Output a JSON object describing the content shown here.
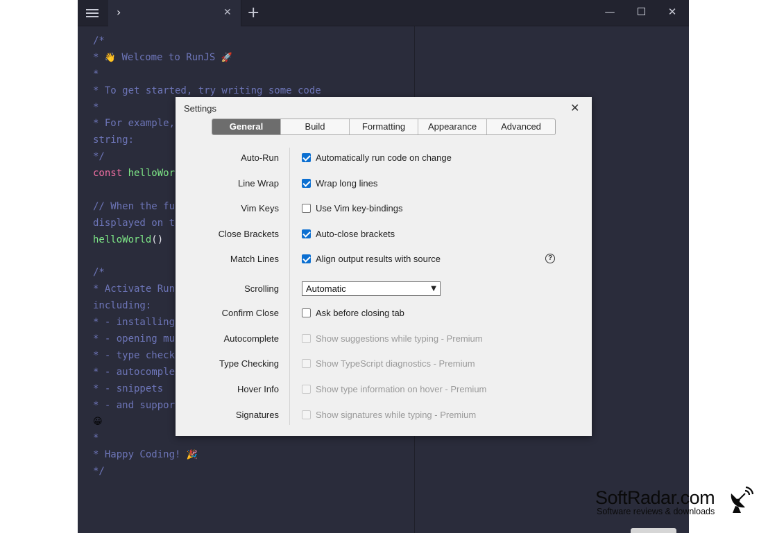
{
  "titlebar": {
    "tab_chevron": "›",
    "tab_close": "✕",
    "new_tab": "+",
    "minimize": "—",
    "close": "✕"
  },
  "code": [
    [
      {
        "t": "/*",
        "c": "c-comment"
      }
    ],
    [
      {
        "t": "* ",
        "c": "c-comment"
      },
      {
        "t": "👋",
        "c": "emoji"
      },
      {
        "t": " Welcome to RunJS ",
        "c": "c-comment"
      },
      {
        "t": "🚀",
        "c": "emoji"
      }
    ],
    [
      {
        "t": "*",
        "c": "c-comment"
      }
    ],
    [
      {
        "t": "* To get started, try writing some code",
        "c": "c-comment"
      }
    ],
    [
      {
        "t": "*",
        "c": "c-comment"
      }
    ],
    [
      {
        "t": "* For example,",
        "c": "c-comment"
      }
    ],
    [
      {
        "t": "string:",
        "c": "c-comment"
      }
    ],
    [
      {
        "t": "*/",
        "c": "c-comment"
      }
    ],
    [
      {
        "t": "const ",
        "c": "c-kw"
      },
      {
        "t": "helloWor",
        "c": "c-fn"
      }
    ],
    [
      {
        "t": "",
        "c": "c-comment"
      }
    ],
    [
      {
        "t": "// When the fu",
        "c": "c-comment"
      }
    ],
    [
      {
        "t": "displayed on t",
        "c": "c-comment"
      }
    ],
    [
      {
        "t": "helloWorld",
        "c": "c-fn"
      },
      {
        "t": "()",
        "c": "c-punc"
      }
    ],
    [
      {
        "t": "",
        "c": "c-comment"
      }
    ],
    [
      {
        "t": "/*",
        "c": "c-comment"
      }
    ],
    [
      {
        "t": "* Activate Run",
        "c": "c-comment"
      }
    ],
    [
      {
        "t": "including:",
        "c": "c-comment"
      }
    ],
    [
      {
        "t": "* - installing",
        "c": "c-comment"
      }
    ],
    [
      {
        "t": "* - opening mu",
        "c": "c-comment"
      }
    ],
    [
      {
        "t": "* - type check",
        "c": "c-comment"
      }
    ],
    [
      {
        "t": "* - autocomple",
        "c": "c-comment"
      }
    ],
    [
      {
        "t": "* - snippets",
        "c": "c-comment"
      }
    ],
    [
      {
        "t": "* - and suppor",
        "c": "c-comment"
      }
    ],
    [
      {
        "t": "😀",
        "c": "emoji"
      }
    ],
    [
      {
        "t": "*",
        "c": "c-comment"
      }
    ],
    [
      {
        "t": "* Happy Coding! ",
        "c": "c-comment"
      },
      {
        "t": "🎉",
        "c": "emoji"
      }
    ],
    [
      {
        "t": "*/",
        "c": "c-comment"
      }
    ]
  ],
  "settings": {
    "title": "Settings",
    "close": "✕",
    "tabs": [
      {
        "label": "General",
        "active": true
      },
      {
        "label": "Build",
        "active": false
      },
      {
        "label": "Formatting",
        "active": false
      },
      {
        "label": "Appearance",
        "active": false
      },
      {
        "label": "Advanced",
        "active": false
      }
    ],
    "rows": {
      "auto_run": {
        "label": "Auto-Run",
        "text": "Automatically run code on change",
        "checked": true
      },
      "line_wrap": {
        "label": "Line Wrap",
        "text": "Wrap long lines",
        "checked": true
      },
      "vim_keys": {
        "label": "Vim Keys",
        "text": "Use Vim key-bindings",
        "checked": false
      },
      "close_brackets": {
        "label": "Close Brackets",
        "text": "Auto-close brackets",
        "checked": true
      },
      "match_lines": {
        "label": "Match Lines",
        "text": "Align output results with source",
        "checked": true,
        "help": "?"
      },
      "scrolling": {
        "label": "Scrolling",
        "value": "Automatic"
      },
      "confirm_close": {
        "label": "Confirm Close",
        "text": "Ask before closing tab",
        "checked": false
      },
      "autocomplete": {
        "label": "Autocomplete",
        "text": "Show suggestions while typing - Premium",
        "checked": false,
        "disabled": true
      },
      "type_checking": {
        "label": "Type Checking",
        "text": "Show TypeScript diagnostics - Premium",
        "checked": false,
        "disabled": true
      },
      "hover_info": {
        "label": "Hover Info",
        "text": "Show type information on hover - Premium",
        "checked": false,
        "disabled": true
      },
      "signatures": {
        "label": "Signatures",
        "text": "Show signatures while typing - Premium",
        "checked": false,
        "disabled": true
      }
    }
  },
  "watermark": {
    "title": "SoftRadar.com",
    "subtitle": "Software reviews & downloads"
  },
  "colors": {
    "editor_bg": "#2a2c3b",
    "comment": "#6d75b8",
    "keyword": "#f16fa3",
    "function": "#7ee787",
    "checkbox_accent": "#0b6fd1",
    "active_tab": "#6d6d6d"
  }
}
